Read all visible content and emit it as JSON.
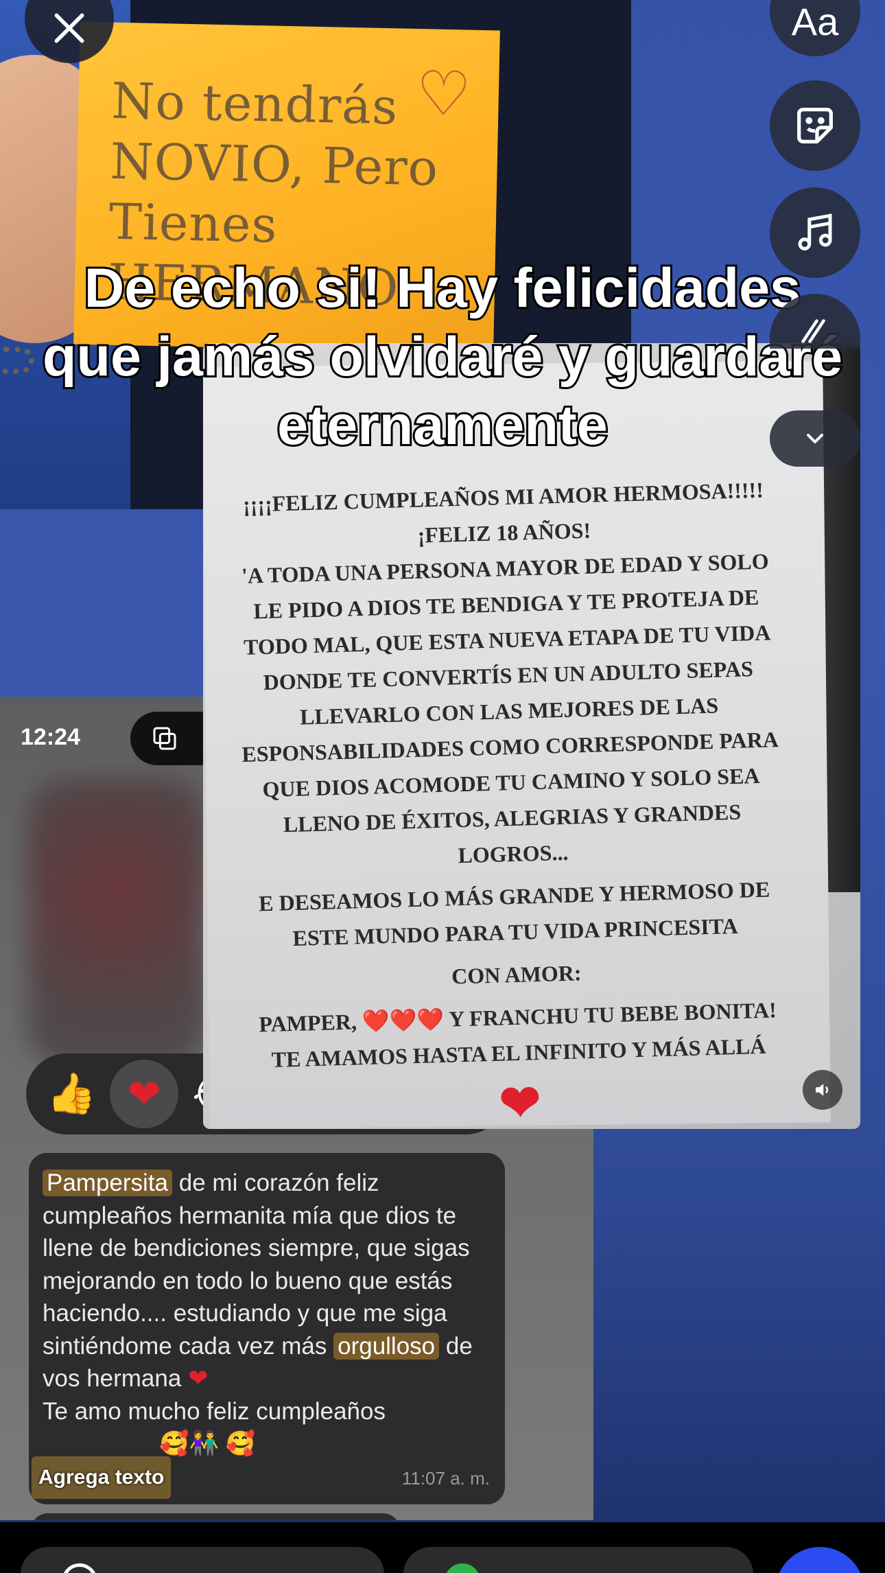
{
  "top_photo": {
    "handwritten": [
      "No tendrás",
      "NOVIO, Pero",
      "Tienes HERMANO"
    ]
  },
  "caption": {
    "line1": "De echo si! Hay felicidades",
    "line2": "que jamás olvidaré y guardaré",
    "line3": "eternamente"
  },
  "note": {
    "lines": [
      "¡¡¡¡FELIZ CUMPLEAÑOS MI AMOR HERMOSA!!!!!",
      "¡FELIZ 18 AÑOS!",
      "'A TODA UNA PERSONA MAYOR DE EDAD Y SOLO",
      "LE PIDO A DIOS TE BENDIGA Y TE PROTEJA DE",
      "TODO MAL, QUE ESTA NUEVA ETAPA DE TU VIDA",
      "DONDE TE CONVERTÍS EN UN ADULTO SEPAS",
      "LLEVARLO CON LAS MEJORES DE LAS",
      "ESPONSABILIDADES COMO CORRESPONDE PARA",
      "QUE DIOS ACOMODE TU CAMINO Y SOLO SEA",
      "LLENO DE ÉXITOS, ALEGRIAS Y GRANDES",
      "LOGROS...",
      "E DESEAMOS LO MÁS GRANDE Y HERMOSO DE",
      "ESTE MUNDO PARA TU VIDA PRINCESITA",
      "CON AMOR:",
      "PAMPER, ❤️❤️❤️ Y FRANCHU TU BEBE BONITA!",
      "TE AMAMOS HASTA EL INFINITO Y MÁS ALLÁ"
    ],
    "heart": "❤"
  },
  "chat": {
    "time": "12:24",
    "reactions": [
      "👍",
      "❤",
      "😂"
    ],
    "message": {
      "highlight1": "Pampersita",
      "part1": " de mi corazón feliz cumpleaños hermanita mía que dios te llene de bendiciones siempre, que sigas mejorando en todo lo bueno que estás haciendo.... estudiando y que me siga sintiéndome cada vez más ",
      "highlight2": "orgulloso",
      "part2": " de vos hermana ",
      "heart": "❤",
      "part3": "Te amo mucho feliz cumpleaños",
      "emojis": "🥰👫 🥰",
      "timestamp": "11:07 a. m."
    }
  },
  "overlay_text_label": "Agrega texto",
  "tools": {
    "text_label": "Aa",
    "icons": [
      "close-icon",
      "sticker-icon",
      "music-note-icon",
      "draw-icon",
      "chevron-down-icon",
      "volume-icon"
    ]
  }
}
